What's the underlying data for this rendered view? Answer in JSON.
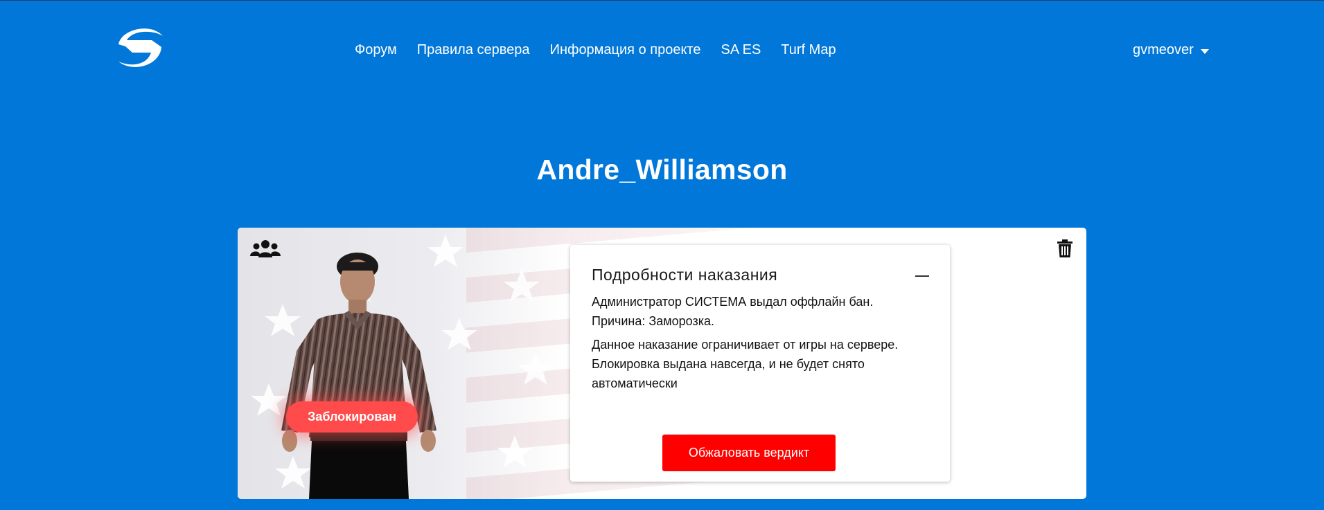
{
  "header": {
    "logo_icon": "g-logo-icon",
    "nav": [
      {
        "label": "Форум"
      },
      {
        "label": "Правила сервера"
      },
      {
        "label": "Информация о проекте"
      },
      {
        "label": "SA ES"
      },
      {
        "label": "Turf Map"
      }
    ],
    "user": {
      "name": "gvmeover",
      "icon": "chevron-down-icon"
    }
  },
  "player": {
    "name": "Andre_Williamson",
    "status": "Заблокирован",
    "status_color": "#ff4b4b"
  },
  "punishment": {
    "title": "Подробности наказания",
    "line1": "Администратор СИСТЕМА выдал оффлайн бан.",
    "line2": "Причина: Заморозка.",
    "description": "Данное наказание ограничивает от игры на сервере. Блокировка выдана навсегда, и не будет снято автоматически",
    "appeal_label": "Обжаловать вердикт",
    "appeal_color": "#ff0000"
  },
  "colors": {
    "background": "#0077d9",
    "card": "#ffffff"
  }
}
